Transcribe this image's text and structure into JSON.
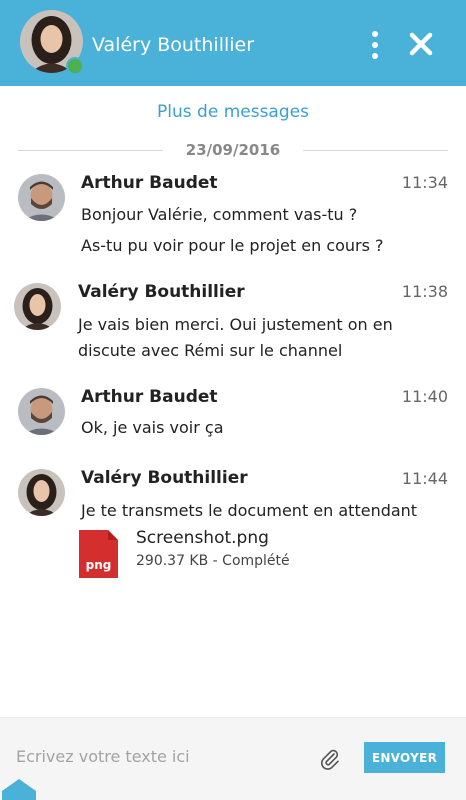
{
  "header": {
    "contact_name": "Valéry Bouthillier",
    "presence": "online",
    "menu_icon": "more-vertical-icon",
    "close_icon": "close-icon"
  },
  "conversation": {
    "more_messages": "Plus de messages",
    "date": "23/09/2016",
    "messages": [
      {
        "author": "Arthur Baudet",
        "time": "11:34",
        "lines": [
          "Bonjour Valérie, comment vas-tu ?",
          "As-tu pu voir pour le projet en cours ?"
        ]
      },
      {
        "author": "Valéry Bouthillier",
        "time": "11:38",
        "lines": [
          "Je vais bien merci. Oui justement on en",
          "discute avec Rémi sur le channel"
        ]
      },
      {
        "author": "Arthur Baudet",
        "time": "11:40",
        "lines": [
          "Ok, je vais voir ça"
        ]
      },
      {
        "author": "Valéry Bouthillier",
        "time": "11:44",
        "lines": [
          "Je te transmets le document en attendant"
        ],
        "attachment": {
          "icon_label": "png",
          "name": "Screenshot.png",
          "meta": "290.37 KB - Complété"
        }
      }
    ]
  },
  "composer": {
    "placeholder": "Ecrivez votre texte ici",
    "value": "",
    "attach_icon": "paperclip-icon",
    "send_label": "ENVOYER"
  },
  "colors": {
    "header": "#4ab1d8",
    "accent": "#3aa0cd",
    "presence": "#4caf50",
    "file_icon": "#d32f2f"
  }
}
